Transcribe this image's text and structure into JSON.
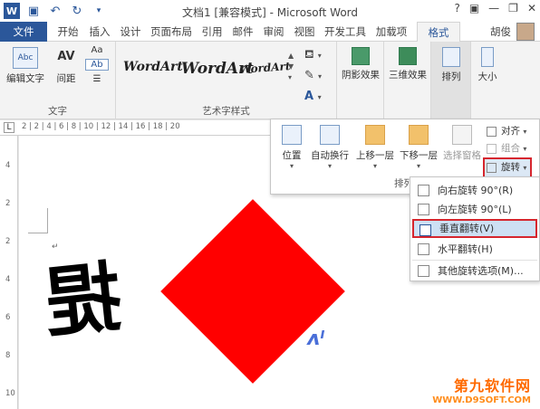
{
  "window": {
    "title": "文档1 [兼容模式] - Microsoft Word",
    "help": "?",
    "user": "胡俊"
  },
  "tabs": [
    "文件",
    "开始",
    "插入",
    "设计",
    "页面布局",
    "引用",
    "邮件",
    "审阅",
    "视图",
    "开发工具",
    "加载项",
    "格式"
  ],
  "ribbon": {
    "text_group": {
      "label": "文字",
      "edit_text": "编辑文字",
      "spacing": "间距",
      "aa_top": "Aa",
      "aa_mid": "Ab"
    },
    "wordart_group": {
      "label": "艺术字样式",
      "styles": [
        "WordArt",
        "WordArt",
        "WordArt"
      ]
    },
    "shadow": "阴影效果",
    "threed": "三维效果",
    "arrange": "排列",
    "size": "大小"
  },
  "ruler": {
    "corner": "L",
    "ticks": "2   |   2   |   4   |   6   |   8   |  10  |  12  |  14  |  16  |  18  |  20",
    "vertical": [
      "4",
      "2",
      "2",
      "4",
      "6",
      "8",
      "10"
    ]
  },
  "arrange_panel": {
    "position": "位置",
    "wrap": "自动换行",
    "bring_forward": "上移一层",
    "send_backward": "下移一层",
    "selection_pane": "选择窗格",
    "align": "对齐",
    "group": "组合",
    "rotate": "旋转",
    "label": "排列"
  },
  "rotate_menu": [
    "向右旋转 90°(R)",
    "向左旋转 90°(L)",
    "垂直翻转(V)",
    "水平翻转(H)",
    "其他旋转选项(M)..."
  ],
  "document": {
    "big_char": "提",
    "paragraph_mark": "↵",
    "shape_color": "#ff0000"
  },
  "watermark": {
    "line1": "第九软件网",
    "line2": "WWW.D9SOFT.COM"
  },
  "colors": {
    "accent": "#2b579a",
    "highlight_border": "#d6262e"
  }
}
